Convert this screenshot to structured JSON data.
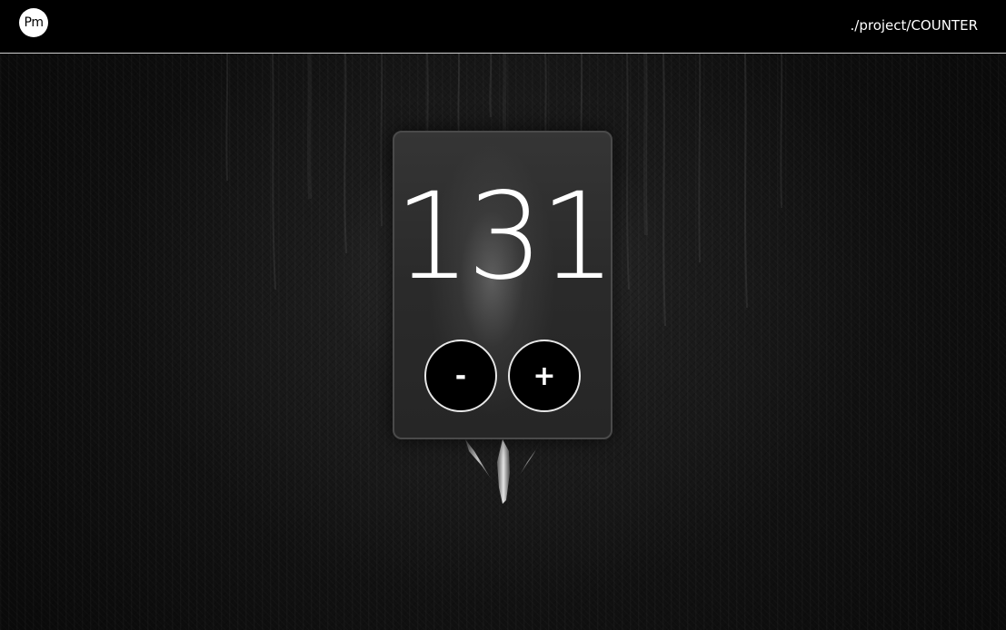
{
  "header": {
    "logo_text": "Pm",
    "breadcrumb": "./project/COUNTER"
  },
  "counter": {
    "value": "131",
    "decrement_label": "-",
    "increment_label": "+"
  },
  "colors": {
    "topbar": "#000000",
    "button_fill": "#000000",
    "button_border": "#e8e8e8",
    "text": "#ffffff"
  }
}
